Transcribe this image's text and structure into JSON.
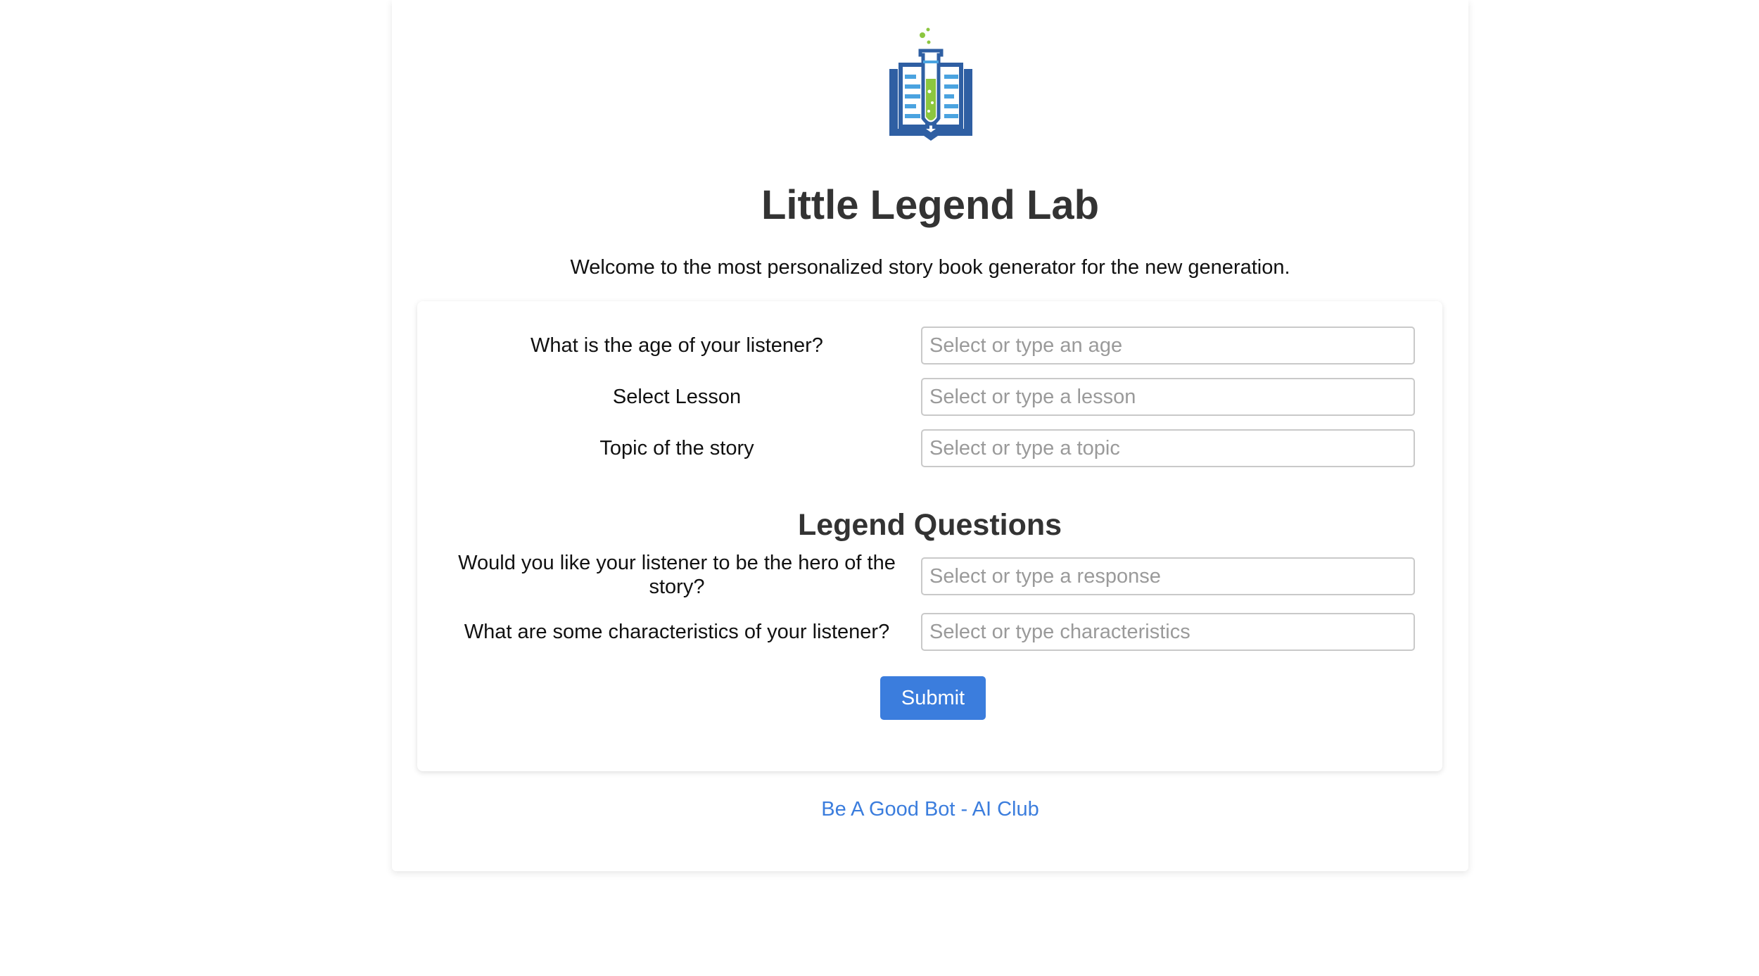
{
  "header": {
    "logo_icon": "book-test-tube-icon",
    "title": "Little Legend Lab",
    "subtitle": "Welcome to the most personalized story book generator for the new generation."
  },
  "form": {
    "age": {
      "label": "What is the age of your listener?",
      "placeholder": "Select or type an age",
      "value": ""
    },
    "lesson": {
      "label": "Select Lesson",
      "placeholder": "Select or type a lesson",
      "value": ""
    },
    "topic": {
      "label": "Topic of the story",
      "placeholder": "Select or type a topic",
      "value": ""
    },
    "legend_section_title": "Legend Questions",
    "hero": {
      "label": "Would you like your listener to be the hero of the story?",
      "placeholder": "Select or type a response",
      "value": ""
    },
    "characteristics": {
      "label": "What are some characteristics of your listener?",
      "placeholder": "Select or type characteristics",
      "value": ""
    },
    "submit_label": "Submit"
  },
  "footer": {
    "link_text": "Be A Good Bot - AI Club"
  },
  "colors": {
    "accent": "#3b7ddd",
    "logo_blue": "#2f5fa3",
    "logo_green": "#8cc63f",
    "logo_light_blue": "#4aa3e0"
  }
}
